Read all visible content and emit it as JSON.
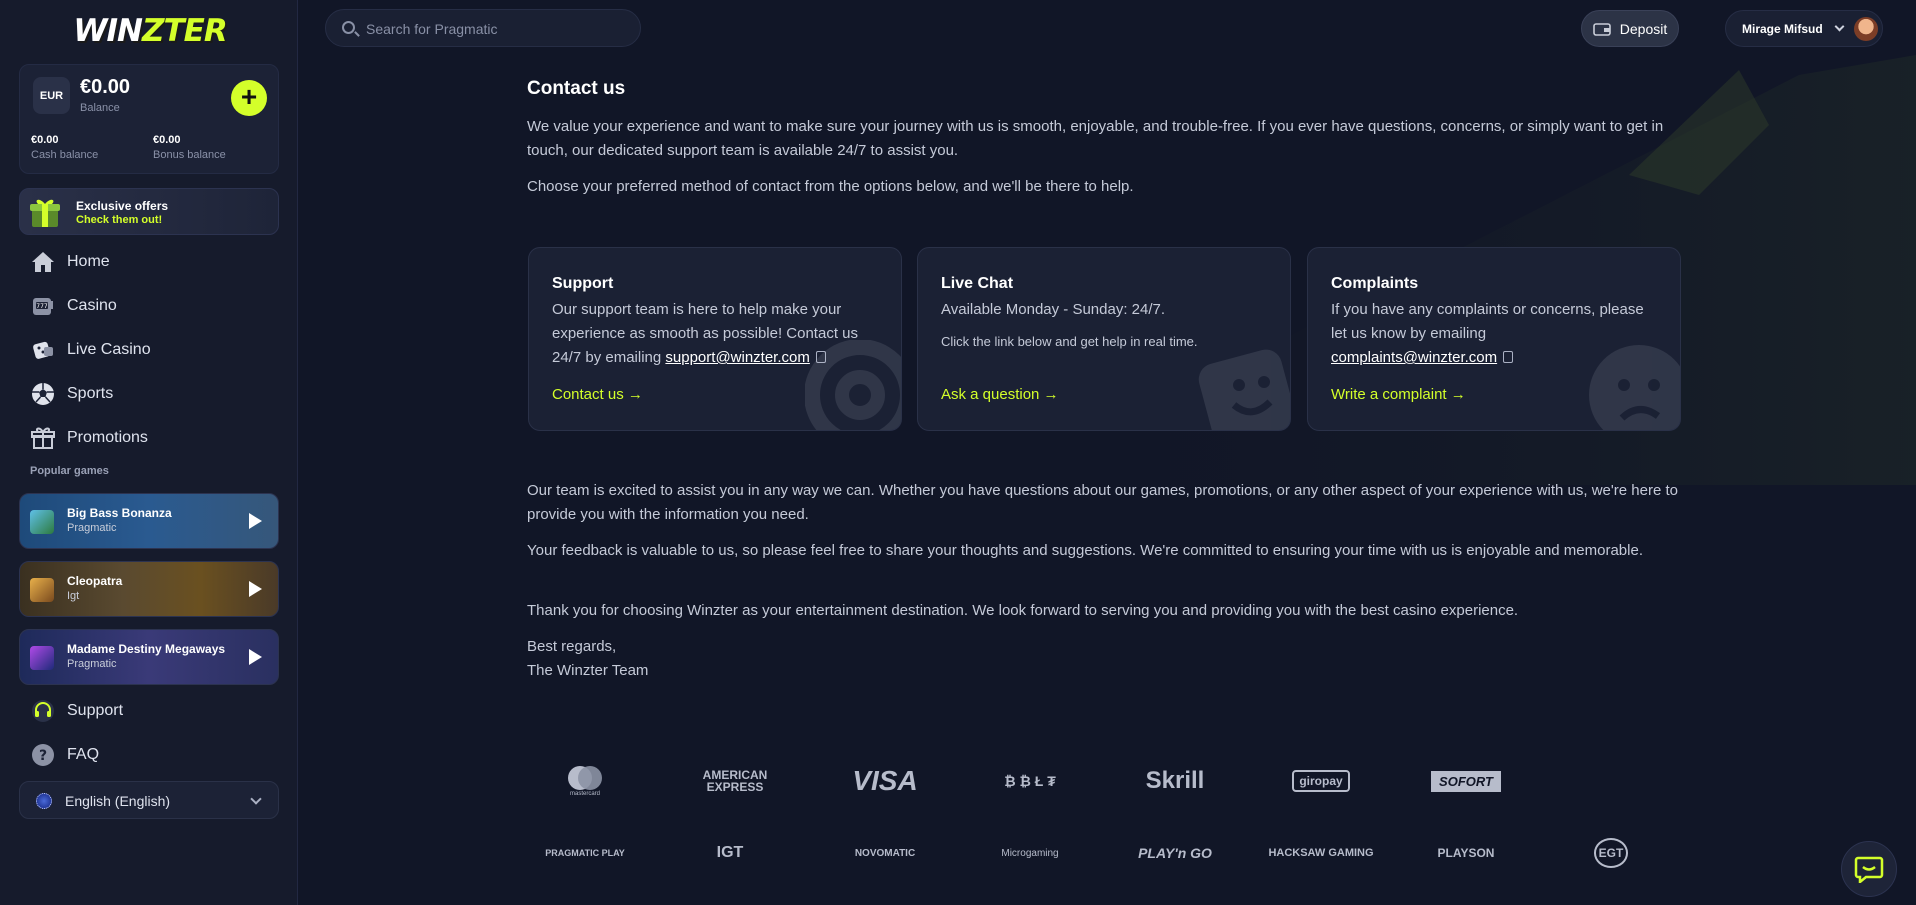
{
  "brand": {
    "logo_part1": "WIN",
    "logo_part2": "ZTER"
  },
  "balance": {
    "currency": "EUR",
    "amount": "€0.00",
    "label": "Balance",
    "cash_value": "€0.00",
    "cash_label": "Cash balance",
    "bonus_value": "€0.00",
    "bonus_label": "Bonus balance"
  },
  "offers": {
    "title": "Exclusive offers",
    "subtitle": "Check them out!"
  },
  "nav": [
    {
      "label": "Home",
      "icon": "home-icon"
    },
    {
      "label": "Casino",
      "icon": "slot-machine-icon"
    },
    {
      "label": "Live Casino",
      "icon": "dice-icon"
    },
    {
      "label": "Sports",
      "icon": "soccer-ball-icon"
    },
    {
      "label": "Promotions",
      "icon": "gift-icon"
    }
  ],
  "popular_games": {
    "label": "Popular games",
    "items": [
      {
        "name": "Big Bass Bonanza",
        "provider": "Pragmatic"
      },
      {
        "name": "Cleopatra",
        "provider": "Igt"
      },
      {
        "name": "Madame Destiny Megaways",
        "provider": "Pragmatic"
      }
    ]
  },
  "nav_bottom": [
    {
      "label": "Support",
      "icon": "headset-icon"
    },
    {
      "label": "FAQ",
      "icon": "question-icon"
    }
  ],
  "language": {
    "selected": "English (English)"
  },
  "search": {
    "placeholder": "Search for Pragmatic"
  },
  "header": {
    "deposit_label": "Deposit",
    "username": "Mirage Mifsud"
  },
  "content": {
    "title": "Contact us",
    "intro_1": "We value your experience and want to make sure your journey with us is smooth, enjoyable, and trouble-free. If you ever have questions, concerns, or simply want to get in touch, our dedicated support team is available 24/7 to assist you.",
    "intro_2": "Choose your preferred method of contact from the options below, and we'll be there to help.",
    "cards": {
      "support": {
        "title": "Support",
        "body": "Our support team is here to help make your experience as smooth as possible! Contact us 24/7 by emailing",
        "email": "support@winzter.com",
        "link": "Contact us →"
      },
      "chat": {
        "title": "Live Chat",
        "body": "Available Monday - Sunday: 24/7.",
        "body_small": "Click the link below and get help in real time.",
        "link": "Ask a question →"
      },
      "complaints": {
        "title": "Complaints",
        "body": "If you have any complaints or concerns, please let us know by emailing",
        "email": "complaints@winzter.com",
        "link": "Write a complaint →"
      }
    },
    "outro_1": "Our team is excited to assist you in any way we can. Whether you have questions about our games, promotions, or any other aspect of your experience with us, we're here to provide you with the information you need.",
    "outro_2": "Your feedback is valuable to us, so please feel free to share your thoughts and suggestions. We're committed to ensuring your time with us is enjoyable and memorable.",
    "outro_3": "Thank you for choosing Winzter as your entertainment destination. We look forward to serving you and providing you with the best casino experience.",
    "sign_1": "Best regards,",
    "sign_2": "The Winzter Team"
  },
  "payments": [
    "mastercard",
    "AMERICAN EXPRESS",
    "VISA",
    "₿ ₿ Ł ₮",
    "Skrill",
    "giropay",
    "SOFORT"
  ],
  "providers": [
    "PRAGMATIC PLAY",
    "IGT",
    "NOVOMATIC",
    "Microgaming",
    "PLAY'n GO",
    "HACKSAW GAMING",
    "PLAYSON",
    "EGT"
  ],
  "colors": {
    "accent": "#d4ff2a",
    "background": "#111627",
    "sidebar": "#161b2c",
    "card": "#1b2134"
  }
}
